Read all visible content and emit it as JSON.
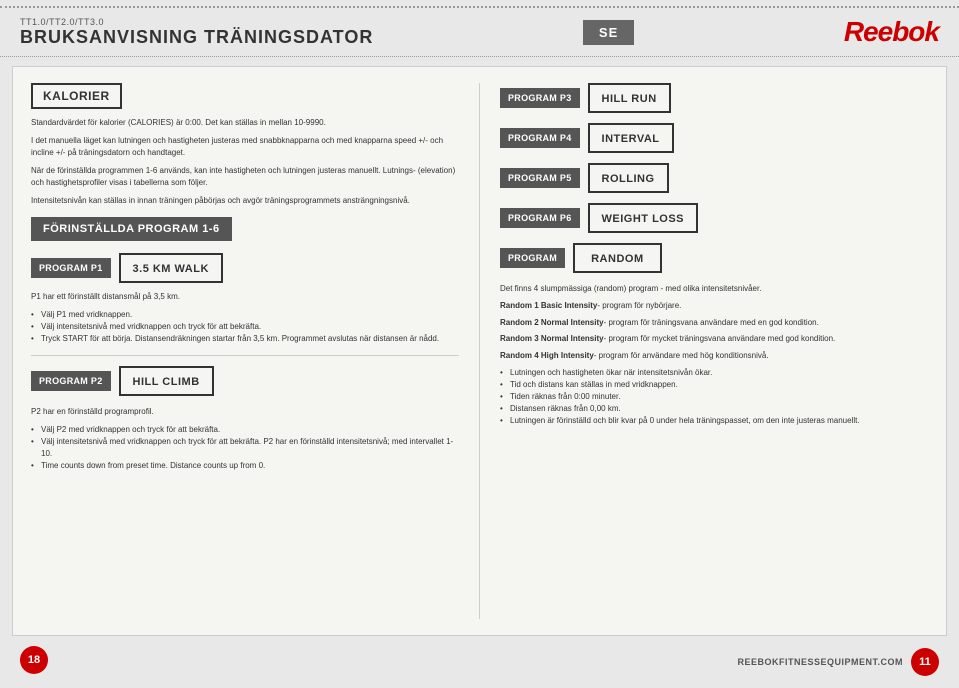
{
  "header": {
    "subtitle": "TT1.0/TT2.0/TT3.0",
    "title": "BRUKSANVISNING TRÄNINGSDATOR",
    "lang_badge": "SE",
    "brand": "Reebok"
  },
  "kalorier": {
    "title": "KALORIER",
    "para1": "Standardvärdet för kalorier (CALORIES) är 0:00. Det kan ställas in mellan 10-9990.",
    "para2": "I det manuella läget kan lutningen och hastigheten justeras med snabbknapparna och med knapparna speed +/- och incline +/- på träningsdatorn och handtaget.",
    "para3": "När de förinställda programmen 1-6 används, kan inte hastigheten och lutningen justeras manuellt. Lutnings- (elevation) och hastighetsprofiler visas i tabellerna som följer.",
    "para4": "Intensitetsnivån kan ställas in innan träningen påbörjas och avgör träningsprogrammets ansträngningsnivå."
  },
  "preset_section": {
    "title": "FÖRINSTÄLLDA PROGRAM 1-6"
  },
  "program_p1": {
    "badge": "PROGRAM P1",
    "label": "3.5 KM WALK",
    "desc": "P1 har ett förinställt distansmål på 3,5 km.",
    "bullets": [
      "Välj P1 med vridknappen.",
      "Välj intensitetsnivå med vridknappen och tryck för att bekräfta.",
      "Tryck START för att börja. Distansendräkningen startar från 3,5 km. Programmet avslutas när distansen är nådd."
    ]
  },
  "program_p2": {
    "badge": "PROGRAM P2",
    "label": "HILL CLIMB",
    "desc": "P2 har en förinställd programprofil.",
    "bullets": [
      "Välj P2 med vridknappen och tryck för att bekräfta.",
      "Välj intensitetsnivå med vridknappen och tryck för att bekräfta. P2 har en förinställd intensitetsnivå; med intervallet 1-10.",
      "Time counts down from preset time. Distance counts up from 0."
    ]
  },
  "right_programs": [
    {
      "badge": "PROGRAM P3",
      "label": "HILL RUN"
    },
    {
      "badge": "PROGRAM P4",
      "label": "INTERVAL"
    },
    {
      "badge": "PROGRAM P5",
      "label": "ROLLING"
    },
    {
      "badge": "PROGRAM P6",
      "label": "WEIGHT LOSS"
    }
  ],
  "random_program": {
    "badge": "PROGRAM",
    "label": "RANDOM",
    "intro": "Det finns 4 slumpmässiga (random) program - med olika intensitetsnivåer.",
    "items": [
      {
        "name": "Random 1 Basic Intensity",
        "desc": "- program för nybörjare."
      },
      {
        "name": "Random 2 Normal Intensity",
        "desc": "- program för träningsvana användare med en god kondition."
      },
      {
        "name": "Random 3 Normal Intensity",
        "desc": "- program för mycket träningsvana användare med god kondition."
      },
      {
        "name": "Random 4 High Intensity",
        "desc": "- program för användare med hög konditionsnivå."
      }
    ],
    "bullets": [
      "Lutningen och hastigheten ökar när intensitetsnivån ökar.",
      "Tid och distans kan ställas in med vridknappen.",
      "Tiden räknas från 0:00 minuter.",
      "Distansen räknas från 0,00 km.",
      "Lutningen är förinställd och blir kvar på 0 under hela träningspasset, om den inte justeras manuellt."
    ]
  },
  "footer": {
    "url": "REEBOKFITNESSEQUIPMENT.COM",
    "icon_left": "18",
    "icon_right": "11"
  }
}
